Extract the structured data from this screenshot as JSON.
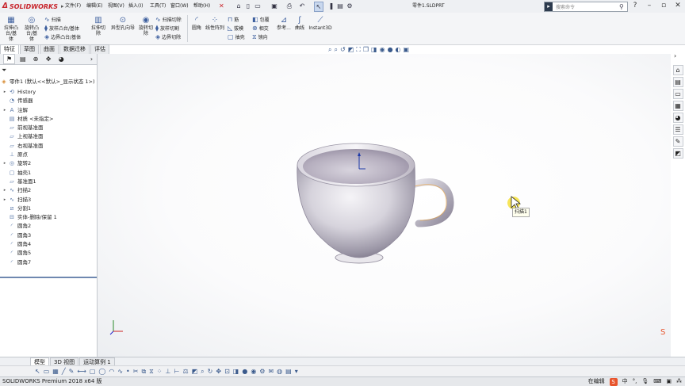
{
  "app": {
    "brand": "SOLIDWORKS",
    "document_title": "零件1.SLDPRT"
  },
  "menus": [
    "文件(F)",
    "编辑(E)",
    "视图(V)",
    "插入(I)",
    "工具(T)",
    "窗口(W)",
    "帮助(H)"
  ],
  "search": {
    "placeholder": "搜索命令"
  },
  "commands": {
    "extrude_boss": "拉伸凸\n台/基体",
    "revolve_boss": "旋转凸\n台/基体",
    "sweep": "扫描",
    "loft": "放样凸台/基体",
    "boundary_boss": "边界凸台/基体",
    "extrude_cut": "拉伸切\n除",
    "hole_wizard": "异型孔向导",
    "revolve_cut": "旋转切\n除",
    "sweep_cut": "扫描切除",
    "loft_cut": "放样切割",
    "boundary_cut": "边界切除",
    "fillet": "圆角",
    "linear_pattern": "线性阵列",
    "rib": "筋",
    "draft": "拔模",
    "shell": "抽壳",
    "wrap": "包覆",
    "intersect": "相交",
    "mirror": "镜向",
    "reference": "参考...",
    "curves": "曲线",
    "instant3d": "Instant3D"
  },
  "tabs": [
    "特征",
    "草图",
    "曲面",
    "数据迁移",
    "评估"
  ],
  "active_tab": 0,
  "feature_tree": [
    {
      "label": "零件1 (默认<<默认>_显示状态 1>)",
      "icon": "part-icon",
      "indent": 0,
      "expand": ""
    },
    {
      "label": "History",
      "icon": "history-icon",
      "indent": 1,
      "expand": "▸"
    },
    {
      "label": "传感器",
      "icon": "sensor-icon",
      "indent": 1,
      "expand": ""
    },
    {
      "label": "注解",
      "icon": "annotation-icon",
      "indent": 1,
      "expand": "▸"
    },
    {
      "label": "材质 <未指定>",
      "icon": "material-icon",
      "indent": 1,
      "expand": ""
    },
    {
      "label": "前视基准面",
      "icon": "plane-icon",
      "indent": 1,
      "expand": ""
    },
    {
      "label": "上视基准面",
      "icon": "plane-icon",
      "indent": 1,
      "expand": ""
    },
    {
      "label": "右视基准面",
      "icon": "plane-icon",
      "indent": 1,
      "expand": ""
    },
    {
      "label": "原点",
      "icon": "origin-icon",
      "indent": 1,
      "expand": ""
    },
    {
      "label": "旋转2",
      "icon": "revolve-icon",
      "indent": 1,
      "expand": "▸"
    },
    {
      "label": "抽壳1",
      "icon": "shell-icon",
      "indent": 1,
      "expand": ""
    },
    {
      "label": "基准面1",
      "icon": "plane-icon",
      "indent": 1,
      "expand": ""
    },
    {
      "label": "扫描2",
      "icon": "sweep-icon",
      "indent": 1,
      "expand": "▸"
    },
    {
      "label": "扫描3",
      "icon": "sweep-icon",
      "indent": 1,
      "expand": "▸"
    },
    {
      "label": "分割1",
      "icon": "split-icon",
      "indent": 1,
      "expand": ""
    },
    {
      "label": "实体-删除/保留 1",
      "icon": "body-delete-icon",
      "indent": 1,
      "expand": ""
    },
    {
      "label": "圆角2",
      "icon": "fillet-icon",
      "indent": 1,
      "expand": ""
    },
    {
      "label": "圆角3",
      "icon": "fillet-icon",
      "indent": 1,
      "expand": ""
    },
    {
      "label": "圆角4",
      "icon": "fillet-icon",
      "indent": 1,
      "expand": ""
    },
    {
      "label": "圆角5",
      "icon": "fillet-icon",
      "indent": 1,
      "expand": ""
    },
    {
      "label": "圆角7",
      "icon": "fillet-icon",
      "indent": 1,
      "expand": ""
    }
  ],
  "tooltip": "扫描1",
  "model_tabs": [
    "模型",
    "3D 视图",
    "运动算例 1"
  ],
  "status": {
    "version": "SOLIDWORKS Premium 2018 x64 版",
    "editing": "在编辑",
    "ime_label": "S",
    "ime_mode": "中"
  },
  "colors": {
    "accent": "#c8252c",
    "icon_blue": "#3d5f9e",
    "cup_shadow": "#6b6478",
    "handle_highlight": "#f0a030"
  }
}
